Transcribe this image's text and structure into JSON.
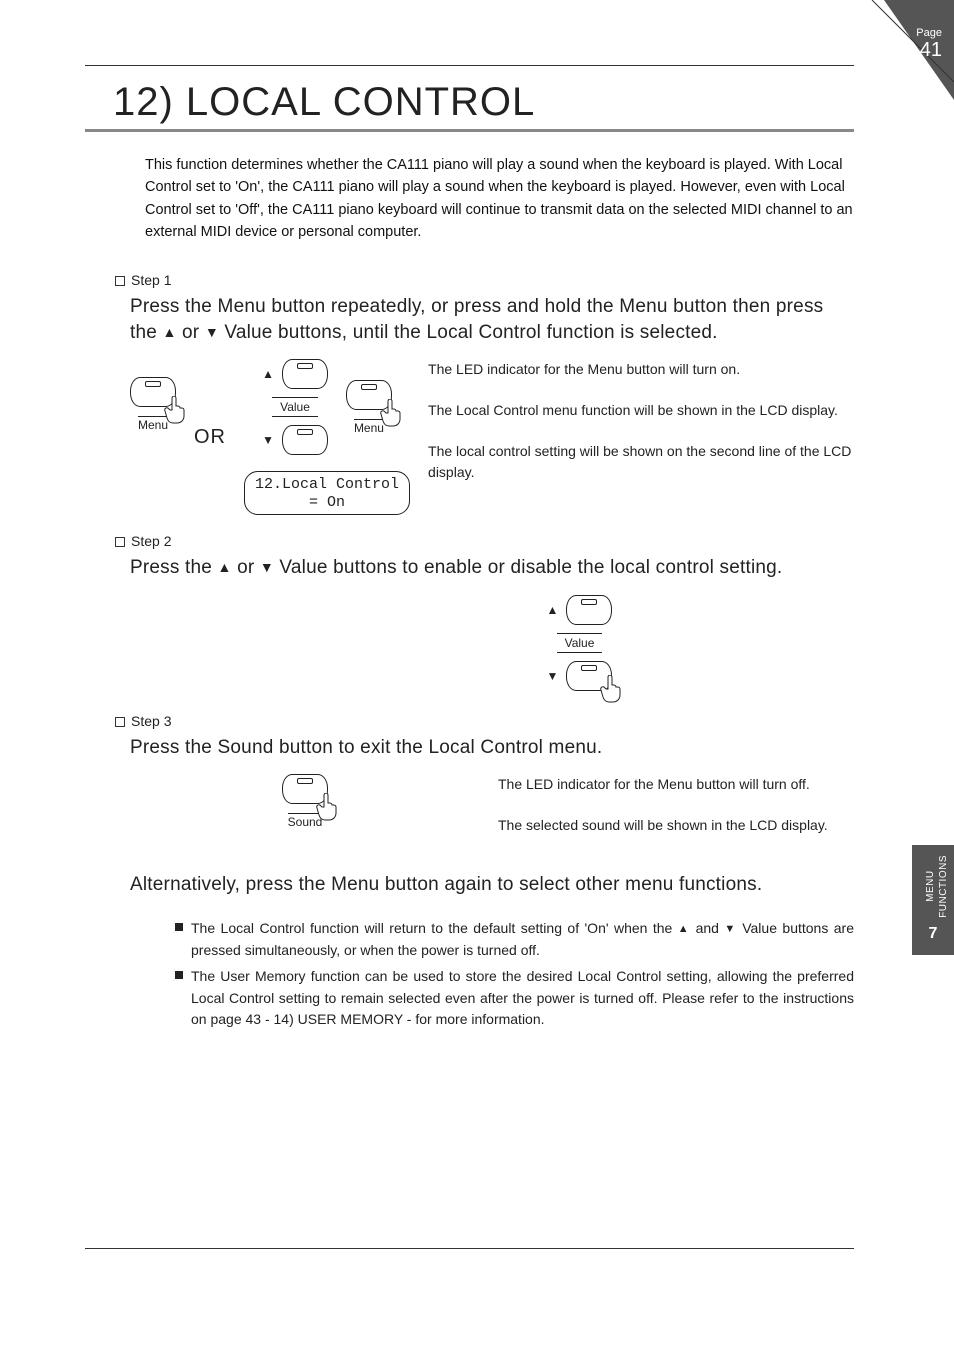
{
  "page": {
    "label": "Page",
    "number": "41"
  },
  "title": "12) LOCAL CONTROL",
  "intro": "This function determines whether the CA111 piano will play a sound when the keyboard is played.\nWith Local Control set to 'On', the CA111 piano will play a sound when the keyboard is played.  However, even with Local Control set to 'Off', the CA111 piano keyboard will continue to transmit data on the selected MIDI channel to an external MIDI device or personal computer.",
  "step1": {
    "head": "Step 1",
    "instruction_a": "Press the Menu button repeatedly, or press and hold the Menu button then press the ",
    "instruction_b": " or ",
    "instruction_c": " Value buttons, until the Local Control function is selected.",
    "or": "OR",
    "menu_label": "Menu",
    "value_label": "Value",
    "lcd_line1": "12.Local Control",
    "lcd_line2": "= On",
    "note1": "The LED indicator for the Menu button will turn on.",
    "note2": "The Local Control menu function will be shown in the LCD display.",
    "note3": "The local control setting will be shown on the second line of the LCD display."
  },
  "step2": {
    "head": "Step 2",
    "instruction_a": "Press the ",
    "instruction_b": " or ",
    "instruction_c": " Value buttons to enable or disable the local control setting.",
    "value_label": "Value"
  },
  "step3": {
    "head": "Step 3",
    "instruction": "Press the Sound button to exit the Local Control menu.",
    "sound_label": "Sound",
    "note1": "The LED indicator for the Menu button will turn off.",
    "note2": "The selected sound will be shown in the LCD display."
  },
  "alt": "Alternatively, press the Menu button again to select other menu functions.",
  "bullets": {
    "b1_a": "The Local Control function will return to the default setting of 'On' when the ",
    "b1_b": " and ",
    "b1_c": " Value buttons are pressed simultaneously, or when the power is turned off.",
    "b2": "The User Memory function can be used to store the desired Local Control setting, allowing the preferred Local Control setting to remain selected even after the power is turned off.  Please refer to the instructions on page 43 - 14) USER MEMORY - for more information."
  },
  "sidetab": {
    "line1": "MENU",
    "line2": "FUNCTIONS",
    "section": "7"
  }
}
